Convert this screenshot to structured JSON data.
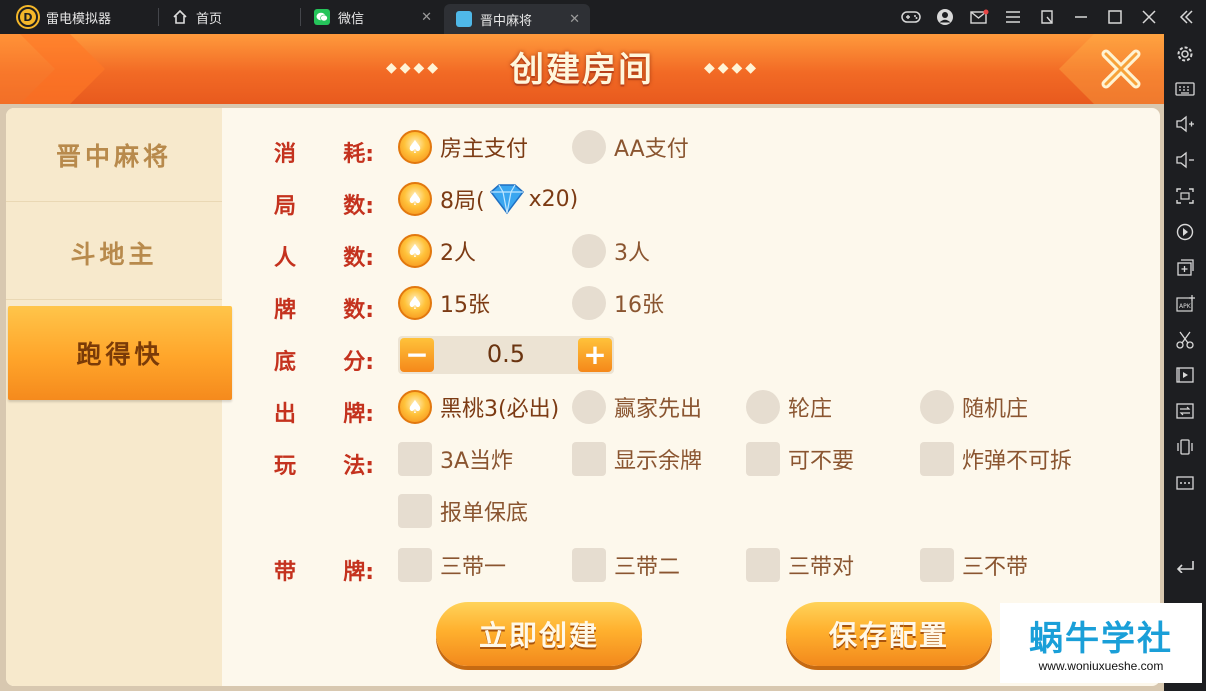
{
  "tabs": [
    {
      "label": "雷电模拟器",
      "icon": "leidian-logo-icon"
    },
    {
      "label": "首页",
      "icon": "home-icon"
    },
    {
      "label": "微信",
      "icon": "wechat-icon"
    },
    {
      "label": "晋中麻将",
      "icon": "game-icon",
      "active": true
    }
  ],
  "window_controls": [
    "gamepad-icon",
    "account-icon",
    "mail-icon",
    "menu-icon",
    "restore-icon",
    "minimize-icon",
    "maximize-icon",
    "close-icon",
    "collapse-icon"
  ],
  "dialog": {
    "title": "创建房间",
    "title_ornament": "◆◆◆◆"
  },
  "nav": {
    "items": [
      {
        "label": "晋中麻将"
      },
      {
        "label": "斗地主"
      },
      {
        "label": "跑得快",
        "active": true
      }
    ]
  },
  "form": {
    "cost": {
      "label_a": "消",
      "label_b": "耗:",
      "options": [
        {
          "text": "房主支付",
          "selected": true
        },
        {
          "text": "AA支付",
          "selected": false
        }
      ]
    },
    "rounds": {
      "label_a": "局",
      "label_b": "数:",
      "option": "8局(",
      "gem_count": "x20)"
    },
    "players": {
      "label_a": "人",
      "label_b": "数:",
      "options": [
        {
          "text": "2人",
          "selected": true
        },
        {
          "text": "3人",
          "selected": false
        }
      ]
    },
    "cards": {
      "label_a": "牌",
      "label_b": "数:",
      "options": [
        {
          "text": "15张",
          "selected": true
        },
        {
          "text": "16张",
          "selected": false
        }
      ]
    },
    "base": {
      "label_a": "底",
      "label_b": "分:",
      "value": "0.5",
      "minus": "−",
      "plus": "+"
    },
    "lead": {
      "label_a": "出",
      "label_b": "牌:",
      "options": [
        {
          "text": "黑桃3(必出)",
          "selected": true
        },
        {
          "text": "赢家先出",
          "selected": false
        },
        {
          "text": "轮庄",
          "selected": false
        },
        {
          "text": "随机庄",
          "selected": false
        }
      ]
    },
    "play": {
      "label_a": "玩",
      "label_b": "法:",
      "options": [
        {
          "text": "3A当炸"
        },
        {
          "text": "显示余牌"
        },
        {
          "text": "可不要"
        },
        {
          "text": "炸弹不可拆"
        },
        {
          "text": "报单保底"
        }
      ]
    },
    "carry": {
      "label_a": "带",
      "label_b": "牌:",
      "options": [
        {
          "text": "三带一"
        },
        {
          "text": "三带二"
        },
        {
          "text": "三带对"
        },
        {
          "text": "三不带"
        }
      ]
    }
  },
  "actions": {
    "create": "立即创建",
    "save": "保存配置"
  },
  "watermark": {
    "title": "蜗牛学社",
    "url": "www.woniuxueshe.com"
  },
  "colors": {
    "header": "#f26a25",
    "label_red": "#c4321e",
    "option_brown": "#7c3b14",
    "button_orange": "#ffb02e",
    "watermark_blue": "#1a9fd8"
  }
}
